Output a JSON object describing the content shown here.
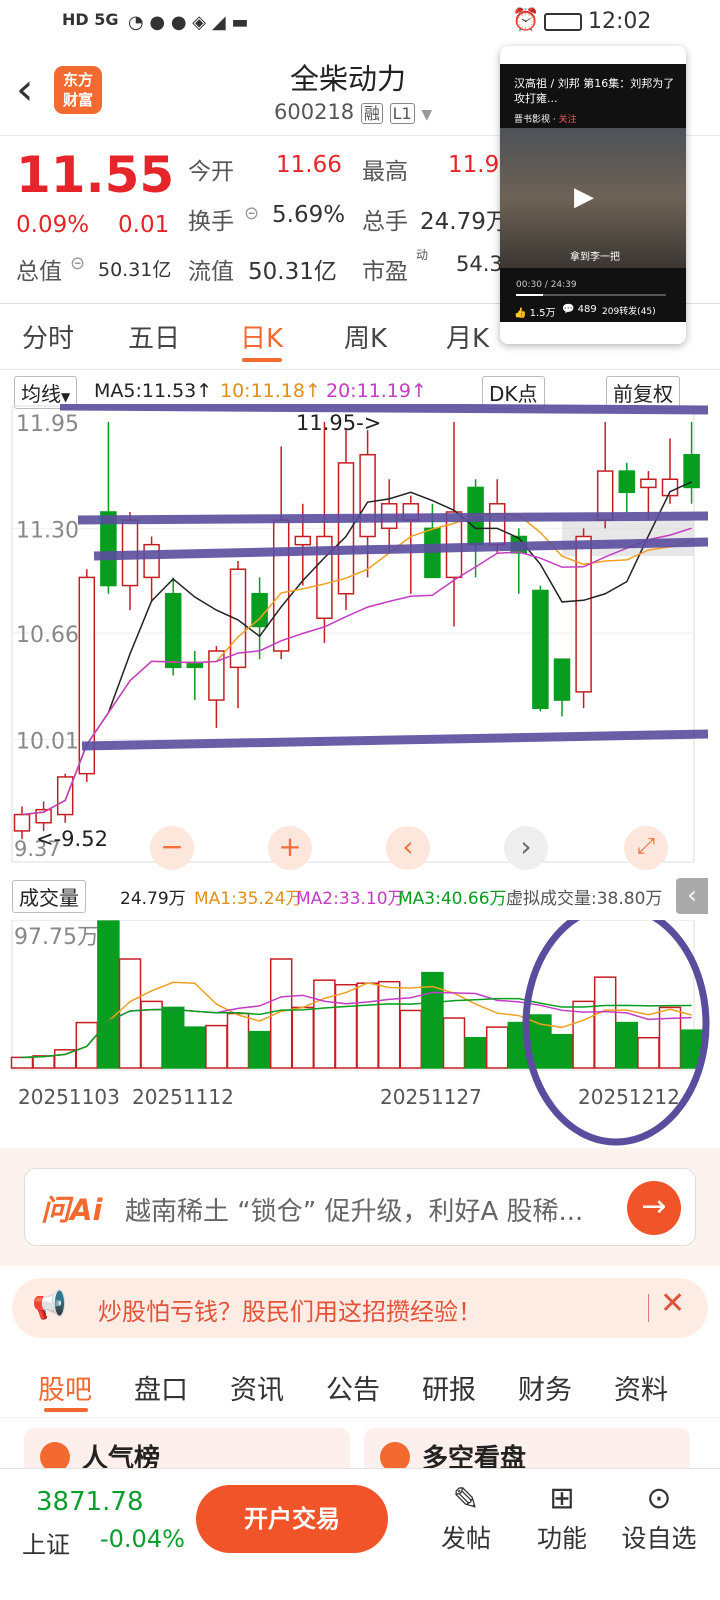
{
  "status": {
    "left_icons": "HD 5G",
    "time": "12:02"
  },
  "header": {
    "logo_line1": "东方",
    "logo_line2": "财富",
    "title": "全柴动力",
    "code": "600218",
    "badge1": "融",
    "badge2": "L1"
  },
  "quote": {
    "price": "11.55",
    "change_pct": "0.09%",
    "change_abs": "0.01",
    "open_label": "今开",
    "open": "11.66",
    "high_label": "最高",
    "high": "11.9",
    "turnover_label": "换手",
    "turnover": "5.69%",
    "volume_label": "总手",
    "volume": "24.79万",
    "mktcap_label": "总值",
    "mktcap": "50.31亿",
    "float_label": "流值",
    "float": "50.31亿",
    "pe_label": "市盈",
    "pe_super": "动",
    "pe": "54.3"
  },
  "tabs": [
    "分时",
    "五日",
    "日K",
    "周K",
    "月K"
  ],
  "active_tab": "日K",
  "chart_legend": {
    "mode": "均线",
    "ma5": "MA5:11.53",
    "ma10": "10:11.18",
    "ma20": "20:11.19",
    "dk": "DK点",
    "adj": "前复权"
  },
  "chart_labels": {
    "p1": "11.95",
    "p2": "11.30",
    "p3": "10.66",
    "p4": "10.01",
    "p5": "9.37",
    "max_marker": "11.95->",
    "min_marker": "<-9.52"
  },
  "volume_legend": {
    "mode": "成交量",
    "v": "24.79万",
    "ma1": "MA1:35.24万",
    "ma2": "MA2:33.10万",
    "ma3": "MA3:40.66万",
    "virtual": "虚拟成交量:38.80万",
    "max": "97.75万"
  },
  "dates": [
    "20251103",
    "20251112",
    "20251127",
    "20251212"
  ],
  "ad_search": {
    "brand": "问Ai",
    "text": "越南稀土 “锁仓” 促升级，利好A 股稀..."
  },
  "banner": {
    "text": "炒股怕亏钱？股民们用这招攒经验！"
  },
  "subtabs": [
    "股吧",
    "盘口",
    "资讯",
    "公告",
    "研报",
    "财务",
    "资料"
  ],
  "cards": {
    "left": "人气榜",
    "right": "多空看盘"
  },
  "bottom": {
    "index_value": "3871.78",
    "index_name": "上证",
    "index_change": "-0.04%",
    "trade_button": "开户交易",
    "post": "发帖",
    "func": "功能",
    "watch": "设自选"
  },
  "video": {
    "title": "汉高祖 / 刘邦 第16集：刘邦为了攻打雍...",
    "channel": "晋书影视",
    "follow": "关注",
    "subtitle": "拿到李一把",
    "time": "00:30 / 24:39",
    "likes": "1.5万",
    "comments": "489",
    "share": "209转发(45)"
  },
  "candles": [
    {
      "o": 9.45,
      "c": 9.55,
      "h": 9.6,
      "l": 9.4
    },
    {
      "o": 9.5,
      "c": 9.58,
      "h": 9.63,
      "l": 9.45
    },
    {
      "o": 9.55,
      "c": 9.78,
      "h": 9.8,
      "l": 9.5
    },
    {
      "o": 9.8,
      "c": 11.0,
      "h": 11.05,
      "l": 9.75
    },
    {
      "o": 11.4,
      "c": 10.95,
      "h": 11.95,
      "l": 10.9
    },
    {
      "o": 10.95,
      "c": 11.35,
      "h": 11.4,
      "l": 10.8
    },
    {
      "o": 11.0,
      "c": 11.2,
      "h": 11.25,
      "l": 10.85
    },
    {
      "o": 10.9,
      "c": 10.45,
      "h": 11.0,
      "l": 10.4
    },
    {
      "o": 10.48,
      "c": 10.45,
      "h": 10.55,
      "l": 10.25
    },
    {
      "o": 10.25,
      "c": 10.55,
      "h": 10.58,
      "l": 10.08
    },
    {
      "o": 10.45,
      "c": 11.05,
      "h": 11.1,
      "l": 10.2
    },
    {
      "o": 10.9,
      "c": 10.7,
      "h": 11.0,
      "l": 10.5
    },
    {
      "o": 10.55,
      "c": 11.35,
      "h": 11.8,
      "l": 10.5
    },
    {
      "o": 11.2,
      "c": 11.25,
      "h": 11.45,
      "l": 10.95
    },
    {
      "o": 10.75,
      "c": 11.25,
      "h": 11.95,
      "l": 10.6
    },
    {
      "o": 10.9,
      "c": 11.7,
      "h": 11.9,
      "l": 10.8
    },
    {
      "o": 11.25,
      "c": 11.75,
      "h": 11.9,
      "l": 11.0
    },
    {
      "o": 11.3,
      "c": 11.45,
      "h": 11.6,
      "l": 11.15
    },
    {
      "o": 11.35,
      "c": 11.45,
      "h": 11.5,
      "l": 10.9
    },
    {
      "o": 11.3,
      "c": 11.0,
      "h": 11.45,
      "l": 11.0
    },
    {
      "o": 11.0,
      "c": 11.4,
      "h": 11.95,
      "l": 10.7
    },
    {
      "o": 11.55,
      "c": 11.2,
      "h": 11.6,
      "l": 11.0
    },
    {
      "o": 11.2,
      "c": 11.45,
      "h": 11.6,
      "l": 11.15
    },
    {
      "o": 11.25,
      "c": 11.15,
      "h": 11.3,
      "l": 10.9
    },
    {
      "o": 10.92,
      "c": 10.2,
      "h": 10.95,
      "l": 10.18
    },
    {
      "o": 10.5,
      "c": 10.25,
      "h": 10.5,
      "l": 10.15
    },
    {
      "o": 10.3,
      "c": 11.25,
      "h": 11.3,
      "l": 10.2
    },
    {
      "o": 11.35,
      "c": 11.65,
      "h": 11.95,
      "l": 11.3
    },
    {
      "o": 11.65,
      "c": 11.52,
      "h": 11.7,
      "l": 11.4
    },
    {
      "o": 11.55,
      "c": 11.6,
      "h": 11.65,
      "l": 11.35
    },
    {
      "o": 11.5,
      "c": 11.6,
      "h": 11.85,
      "l": 11.45
    },
    {
      "o": 11.75,
      "c": 11.55,
      "h": 11.95,
      "l": 11.45
    }
  ],
  "volumes": [
    7,
    8,
    12,
    30,
    97,
    72,
    44,
    40,
    27,
    28,
    36,
    24,
    72,
    40,
    58,
    55,
    56,
    57,
    38,
    63,
    33,
    20,
    27,
    30,
    35,
    22,
    44,
    60,
    30,
    20,
    40,
    25
  ],
  "colors": {
    "up": "#c41e22",
    "down": "#079e1f",
    "ma5": "#222222",
    "ma10": "#f0a020",
    "ma20": "#c43cc4",
    "annot": "#5a4d9e",
    "accent": "#f26a2f"
  }
}
